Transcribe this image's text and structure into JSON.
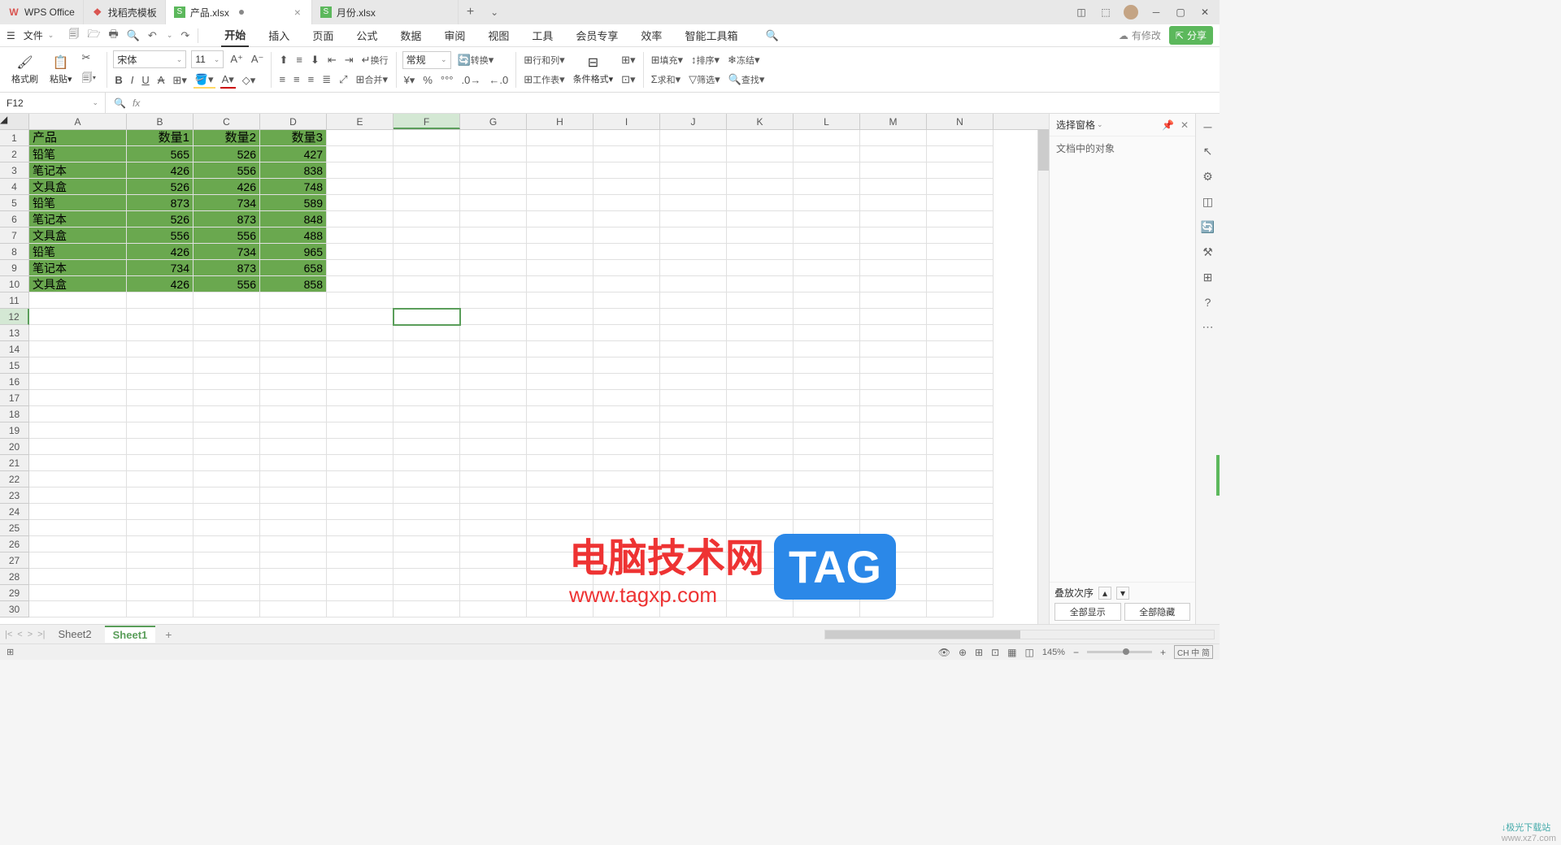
{
  "tabs": [
    {
      "icon": "W",
      "iconColor": "#d9534f",
      "label": "WPS Office"
    },
    {
      "icon": "D",
      "iconColor": "#d9534f",
      "label": "找稻壳模板"
    },
    {
      "icon": "S",
      "iconColor": "#5cb85c",
      "label": "产品.xlsx",
      "active": true,
      "dot": true
    },
    {
      "icon": "S",
      "iconColor": "#5cb85c",
      "label": "月份.xlsx"
    }
  ],
  "addTab": "+",
  "winDropdown": "⌄",
  "fileMenu": "文件",
  "qat": {
    "save": "🖫",
    "open": "🗁",
    "print": "🖨",
    "preview": "⎙",
    "undo": "↶",
    "redo": "↷"
  },
  "menus": [
    "开始",
    "插入",
    "页面",
    "公式",
    "数据",
    "审阅",
    "视图",
    "工具",
    "会员专享",
    "效率",
    "智能工具箱"
  ],
  "activeMenu": 0,
  "modifyText": "有修改",
  "shareText": "分享",
  "ribbon": {
    "formatPainter": "格式刷",
    "paste": "粘贴",
    "cut": "✂",
    "fontName": "宋体",
    "fontSize": "11",
    "bold": "B",
    "italic": "I",
    "underline": "U",
    "strike": "S",
    "border": "⊞",
    "fillColor": "#ffd966",
    "fontColor": "#c00",
    "wrap": "换行",
    "merge": "合并",
    "numFormat": "常规",
    "convert": "转换",
    "rowCol": "行和列",
    "worksheet": "工作表",
    "condFmt": "条件格式",
    "tableStyle": "⊞",
    "fill": "填充",
    "sort": "排序",
    "freeze": "冻结",
    "sum": "求和",
    "filter": "筛选",
    "find": "查找"
  },
  "nameBox": "F12",
  "fx": "fx",
  "columns": [
    "A",
    "B",
    "C",
    "D",
    "E",
    "F",
    "G",
    "H",
    "I",
    "J",
    "K",
    "L",
    "M",
    "N"
  ],
  "colWidths": [
    "cw-A",
    "cw-B",
    "cw-C",
    "cw-D",
    "cw-E",
    "cw-F",
    "cw-G",
    "cw-H",
    "cw-I",
    "cw-J",
    "cw-K",
    "cw-L",
    "cw-M",
    "cw-N"
  ],
  "headerRow": [
    "产品",
    "数量1",
    "数量2",
    "数量3"
  ],
  "data": [
    [
      "铅笔",
      "565",
      "526",
      "427"
    ],
    [
      "笔记本",
      "426",
      "556",
      "838"
    ],
    [
      "文具盒",
      "526",
      "426",
      "748"
    ],
    [
      "铅笔",
      "873",
      "734",
      "589"
    ],
    [
      "笔记本",
      "526",
      "873",
      "848"
    ],
    [
      "文具盒",
      "556",
      "556",
      "488"
    ],
    [
      "铅笔",
      "426",
      "734",
      "965"
    ],
    [
      "笔记本",
      "734",
      "873",
      "658"
    ],
    [
      "文具盒",
      "426",
      "556",
      "858"
    ]
  ],
  "activeCell": {
    "row": 12,
    "col": "F"
  },
  "selectedCol": "F",
  "selectedRow": 12,
  "totalRows": 30,
  "rightPanel": {
    "title": "选择窗格",
    "subtitle": "文档中的对象",
    "stackOrder": "叠放次序",
    "showAll": "全部显示",
    "hideAll": "全部隐藏"
  },
  "sheets": [
    {
      "name": "Sheet2"
    },
    {
      "name": "Sheet1",
      "active": true
    }
  ],
  "zoom": "145%",
  "statusIcon": "卽",
  "watermark": {
    "text": "电脑技术网",
    "url": "www.tagxp.com",
    "tag": "TAG"
  },
  "dlMark": "↓极光下载站",
  "dlUrl": "www.xz7.com",
  "langIndicator": "CH 中 简"
}
